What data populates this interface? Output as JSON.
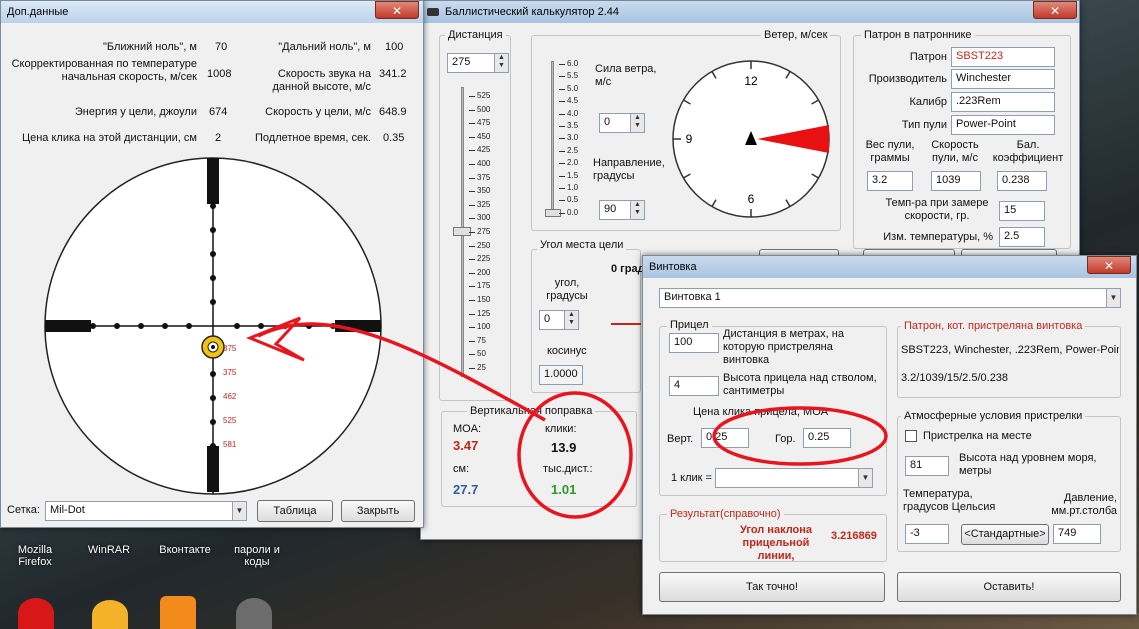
{
  "desktop": {
    "icons": [
      {
        "label": "Mozilla Firefox"
      },
      {
        "label": "WinRAR"
      },
      {
        "label": "Вконтакте"
      },
      {
        "label": "пароли и коды"
      }
    ]
  },
  "extra_window": {
    "title": "Доп.данные",
    "close": "✕",
    "rows": [
      {
        "label": "\"Ближний ноль\", м",
        "value": "70"
      },
      {
        "label": "Скорректированная по температуре начальная скорость, м/сек",
        "value": "1008"
      },
      {
        "label": "Энергия у цели, джоули",
        "value": "674"
      },
      {
        "label": "Цена клика на этой дистанции, см",
        "value": "2"
      }
    ],
    "rows_right": [
      {
        "label": "\"Дальний ноль\", м",
        "value": "100"
      },
      {
        "label": "Скорость звука на данной высоте, м/с",
        "value": "341.2"
      },
      {
        "label": "Скорость у цели, м/с",
        "value": "648.9"
      },
      {
        "label": "Подлетное время, сек.",
        "value": "0.35"
      }
    ],
    "reticle_marks": [
      "375",
      "375",
      "462",
      "525",
      "581"
    ],
    "reticle_label": "Сетка:",
    "reticle_value": "Mil-Dot",
    "table_button": "Таблица",
    "close_button": "Закрыть"
  },
  "main_window": {
    "title": "Баллистический калькулятор 2.44",
    "close": "✕",
    "distance": {
      "label": "Дистанция",
      "value": "275",
      "scale": [
        "525",
        "500",
        "475",
        "450",
        "425",
        "400",
        "375",
        "350",
        "325",
        "300",
        "275",
        "250",
        "225",
        "200",
        "175",
        "150",
        "125",
        "100",
        "75",
        "50",
        "25"
      ]
    },
    "wind": {
      "label": "Ветер, м/сек",
      "scale": [
        "6.0",
        "5.5",
        "5.0",
        "4.5",
        "4.0",
        "3.5",
        "3.0",
        "2.5",
        "2.0",
        "1.5",
        "1.0",
        "0.5",
        "0.0"
      ],
      "strength_label": "Сила ветра, м/с",
      "strength_value": "0",
      "direction_label": "Направление, градусы",
      "direction_value": "90",
      "clock": [
        "12",
        "3",
        "6",
        "9"
      ]
    },
    "angle": {
      "label": "Угол места цели",
      "deg_label": "угол, градусы",
      "deg_value": "0",
      "cos_label": "косинус",
      "cos_value": "1.0000",
      "zero_text": "0 град"
    },
    "vertical": {
      "label": "Вертикальная поправка",
      "moa_label": "MOA:",
      "moa_value": "3.47",
      "clicks_label": "клики:",
      "clicks_value": "13.9",
      "cm_label": "см:",
      "cm_value": "27.7",
      "thousandth_label": "тыс.дист.:",
      "thousandth_value": "1.01"
    },
    "cartridge": {
      "label": "Патрон в патроннике",
      "cartridge_label": "Патрон",
      "cartridge_value": "SBST223",
      "maker_label": "Производитель",
      "maker_value": "Winchester",
      "caliber_label": "Калибр",
      "caliber_value": ".223Rem",
      "bullet_label": "Тип пули",
      "bullet_value": "Power-Point",
      "weight_label": "Вес пули, граммы",
      "weight_value": "3.2",
      "speed_label": "Скорость пули, м/с",
      "speed_value": "1039",
      "bc_label": "Бал. коэффициент",
      "bc_value": "0.238",
      "temp_label": "Темп-ра при замере скорости, гр.",
      "temp_value": "15",
      "change_label": "Изм. температуры, %",
      "change_value": "2.5"
    }
  },
  "rifle_window": {
    "title": "Винтовка",
    "close": "✕",
    "rifle_select": "Винтовка 1",
    "sight": {
      "label": "Прицел",
      "distance_value": "100",
      "distance_label": "Дистанция в метрах, на которую пристреляна винтовка",
      "height_value": "4",
      "height_label": "Высота прицела над стволом, сантиметры",
      "click_label": "Цена клика прицела, MOA",
      "vert_label": "Верт.",
      "vert_value": "0.25",
      "hor_label": "Гор.",
      "hor_value": "0.25",
      "one_click_label": "1 клик ="
    },
    "zeroed_cartridge": {
      "label": "Патрон, кот. пристреляна винтовка",
      "line1": "SBST223, Winchester, .223Rem, Power-Poin",
      "line2": "3.2/1039/15/2.5/0.238"
    },
    "atmosphere": {
      "label": "Атмосферные условия пристрелки",
      "on_site_label": "Пристрелка на месте",
      "altitude_value": "81",
      "altitude_label": "Высота над уровнем моря, метры",
      "temp_label": "Температура, градусов Цельсия",
      "pressure_label": "Давление, мм.рт.столба",
      "temp_value": "-3",
      "standard_button": "<Стандартные>",
      "pressure_value": "749"
    },
    "result": {
      "label": "Результат(справочно)",
      "text": "Угол наклона прицельной линии,",
      "value": "3.216869"
    },
    "ok_button": "Так точно!",
    "leave_button": "Оставить!"
  },
  "colors": {
    "annotation": "#e8141e",
    "title_bar": "#b9d1ea",
    "wind_wedge": "#e81010"
  }
}
